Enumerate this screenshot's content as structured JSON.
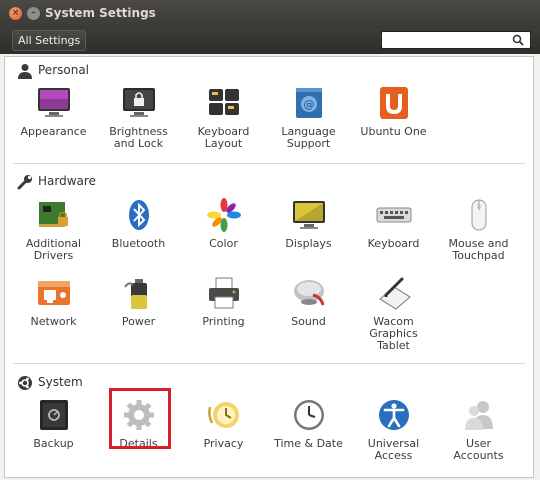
{
  "window": {
    "title": "System Settings"
  },
  "toolbar": {
    "all_settings_label": "All Settings",
    "search_value": ""
  },
  "sections": [
    {
      "name": "Personal",
      "icon": "person-icon",
      "items": [
        {
          "label": "Appearance",
          "icon": "appearance-icon"
        },
        {
          "label": "Brightness\nand Lock",
          "icon": "brightness-lock-icon"
        },
        {
          "label": "Keyboard\nLayout",
          "icon": "keyboard-layout-icon"
        },
        {
          "label": "Language\nSupport",
          "icon": "language-support-icon"
        },
        {
          "label": "Ubuntu One",
          "icon": "ubuntu-one-icon"
        }
      ]
    },
    {
      "name": "Hardware",
      "icon": "wrench-icon",
      "items": [
        {
          "label": "Additional\nDrivers",
          "icon": "additional-drivers-icon"
        },
        {
          "label": "Bluetooth",
          "icon": "bluetooth-icon"
        },
        {
          "label": "Color",
          "icon": "color-icon"
        },
        {
          "label": "Displays",
          "icon": "displays-icon"
        },
        {
          "label": "Keyboard",
          "icon": "keyboard-icon"
        },
        {
          "label": "Mouse and\nTouchpad",
          "icon": "mouse-icon"
        },
        {
          "label": "Network",
          "icon": "network-icon"
        },
        {
          "label": "Power",
          "icon": "power-icon"
        },
        {
          "label": "Printing",
          "icon": "printer-icon"
        },
        {
          "label": "Sound",
          "icon": "sound-icon"
        },
        {
          "label": "Wacom\nGraphics\nTablet",
          "icon": "wacom-tablet-icon"
        }
      ]
    },
    {
      "name": "System",
      "icon": "system-icon",
      "items": [
        {
          "label": "Backup",
          "icon": "backup-safe-icon"
        },
        {
          "label": "Details",
          "icon": "details-gear-icon",
          "highlighted": true
        },
        {
          "label": "Privacy",
          "icon": "privacy-icon"
        },
        {
          "label": "Time & Date",
          "icon": "clock-icon"
        },
        {
          "label": "Universal\nAccess",
          "icon": "universal-access-icon"
        },
        {
          "label": "User\nAccounts",
          "icon": "user-accounts-icon"
        }
      ]
    }
  ],
  "colors": {
    "highlight": "#d6212b",
    "titlebar": "#3c3b37"
  }
}
